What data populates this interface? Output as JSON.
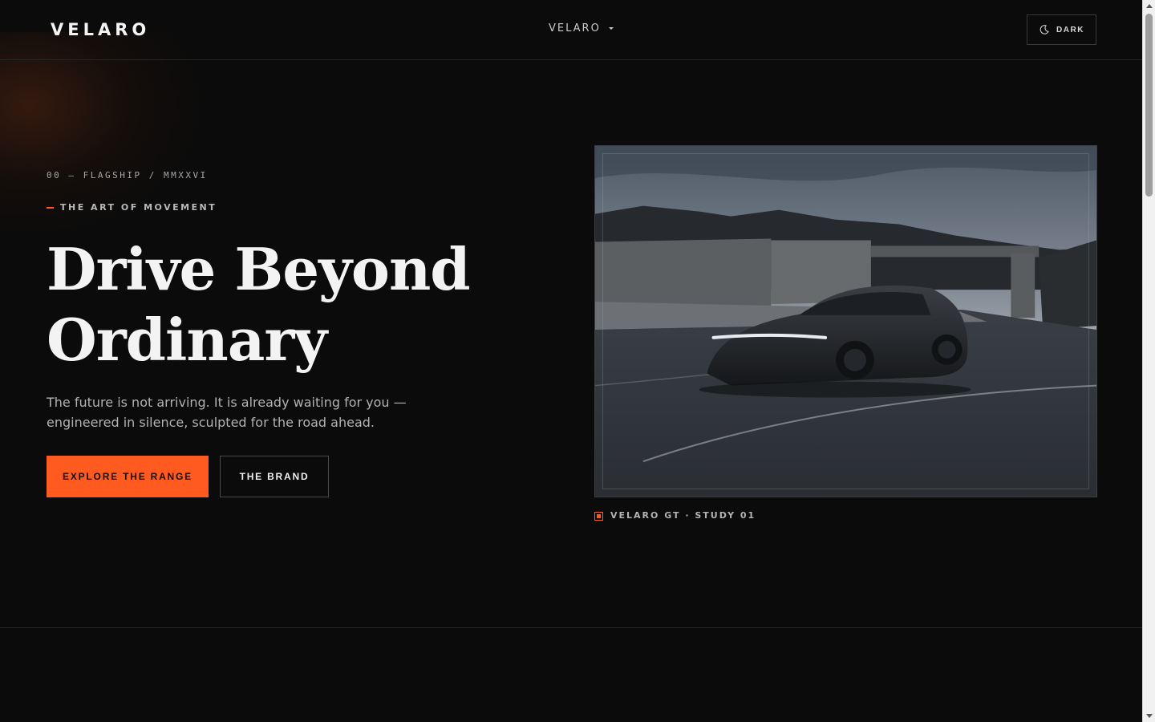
{
  "header": {
    "logo": "VELARO",
    "nav_dropdown_label": "VELARO",
    "theme_toggle_label": "DARK"
  },
  "hero": {
    "eyebrow": "00 — FLAGSHIP / MMXXVI",
    "tagline": "THE ART OF MOVEMENT",
    "headline_line1": "Drive Beyond",
    "headline_line2": "Ordinary",
    "lede": "The future is not arriving. It is already waiting for you — engineered in silence, sculpted for the road ahead.",
    "primary_cta": "EXPLORE THE RANGE",
    "secondary_cta": "THE BRAND",
    "media_caption": "VELARO GT · STUDY 01"
  },
  "icons": {
    "theme": "moon-icon",
    "caption": "square-dot-icon",
    "dropdown": "chevron-down-icon"
  },
  "colors": {
    "accent": "#ff5a1f",
    "background": "#0b0b0b",
    "text": "#f3f3f3"
  }
}
